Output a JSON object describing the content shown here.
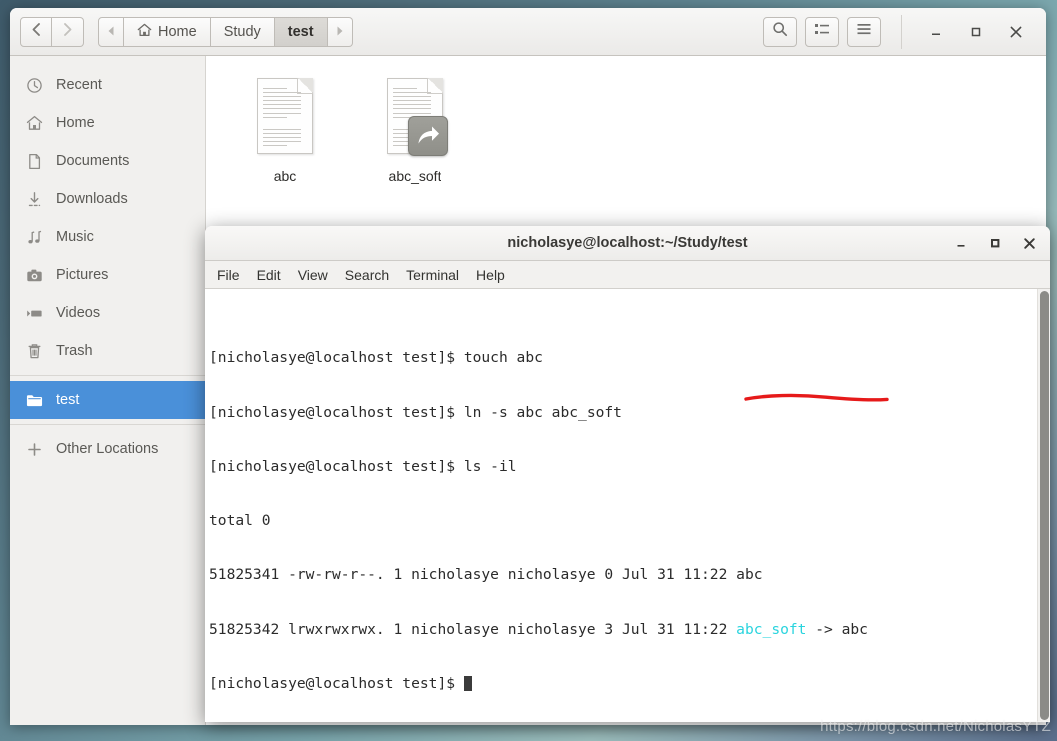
{
  "desktop": {
    "watermark": "https://blog.csdn.net/NicholasYTZ"
  },
  "filemanager": {
    "nav": {
      "back_icon": "chevron-left-icon",
      "forward_icon": "chevron-right-icon"
    },
    "pathbar": {
      "prev_arrow": "triangle-left-icon",
      "next_arrow": "triangle-right-icon",
      "crumbs": [
        {
          "label": "Home",
          "icon": "home-icon",
          "active": false
        },
        {
          "label": "Study",
          "icon": "",
          "active": false
        },
        {
          "label": "test",
          "icon": "",
          "active": true
        }
      ]
    },
    "toolbar": {
      "search_icon": "search-icon",
      "viewlist_icon": "view-list-icon",
      "menu_icon": "hamburger-menu-icon"
    },
    "window_controls": {
      "minimize": "–",
      "maximize": "□",
      "close": "×"
    },
    "sidebar": {
      "items": [
        {
          "label": "Recent",
          "icon": "clock-icon",
          "selected": false
        },
        {
          "label": "Home",
          "icon": "home-icon",
          "selected": false
        },
        {
          "label": "Documents",
          "icon": "document-icon",
          "selected": false
        },
        {
          "label": "Downloads",
          "icon": "download-icon",
          "selected": false
        },
        {
          "label": "Music",
          "icon": "music-icon",
          "selected": false
        },
        {
          "label": "Pictures",
          "icon": "camera-icon",
          "selected": false
        },
        {
          "label": "Videos",
          "icon": "video-icon",
          "selected": false
        },
        {
          "label": "Trash",
          "icon": "trash-icon",
          "selected": false
        }
      ],
      "selected_item": {
        "label": "test",
        "icon": "folder-icon",
        "selected": true
      },
      "other_locations": {
        "label": "Other Locations",
        "icon": "plus-icon"
      }
    },
    "files": [
      {
        "name": "abc",
        "icon": "text-document-icon",
        "emblem": ""
      },
      {
        "name": "abc_soft",
        "icon": "text-document-icon",
        "emblem": "symlink-emblem-icon"
      }
    ]
  },
  "terminal": {
    "title": "nicholasye@localhost:~/Study/test",
    "window_controls": {
      "minimize": "–",
      "maximize": "□",
      "close": "×"
    },
    "menus": [
      "File",
      "Edit",
      "View",
      "Search",
      "Terminal",
      "Help"
    ],
    "prompt": "[nicholasye@localhost test]$ ",
    "lines": [
      {
        "type": "prompt",
        "prompt": "[nicholasye@localhost test]$ ",
        "command": "touch abc"
      },
      {
        "type": "prompt",
        "prompt": "[nicholasye@localhost test]$ ",
        "command": "ln -s abc abc_soft"
      },
      {
        "type": "prompt",
        "prompt": "[nicholasye@localhost test]$ ",
        "command": "ls -il"
      },
      {
        "type": "output",
        "text": "total 0"
      },
      {
        "type": "output",
        "text": "51825341 -rw-rw-r--. 1 nicholasye nicholasye 0 Jul 31 11:22 abc"
      },
      {
        "type": "symlink",
        "prefix": "51825342 lrwxrwxrwx. 1 nicholasye nicholasye 3 Jul 31 11:22 ",
        "link": "abc_soft",
        "suffix": " -> abc"
      },
      {
        "type": "cursor",
        "prompt": "[nicholasye@localhost test]$ "
      }
    ],
    "colors": {
      "symlink_cyan": "#2ad4de",
      "annotation_red": "#e61a1a",
      "foreground": "#2b2b2b",
      "background": "#ffffff"
    },
    "annotation": {
      "shape": "red-underline",
      "target": "abc_soft"
    }
  }
}
